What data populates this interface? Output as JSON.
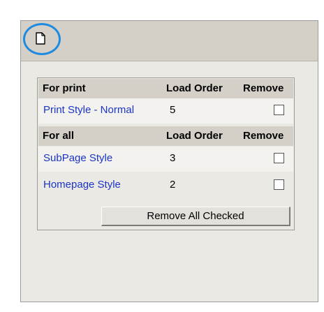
{
  "header": {
    "icon": "document-icon"
  },
  "print_section": {
    "name_header": "For print",
    "order_header": "Load Order",
    "remove_header": "Remove",
    "rows": [
      {
        "name": "Print Style - Normal",
        "order": "5",
        "checked": false
      }
    ]
  },
  "all_section": {
    "name_header": "For all",
    "order_header": "Load Order",
    "remove_header": "Remove",
    "rows": [
      {
        "name": "SubPage Style",
        "order": "3",
        "checked": false
      },
      {
        "name": "Homepage Style",
        "order": "2",
        "checked": false
      }
    ]
  },
  "remove_all_label": "Remove All Checked",
  "colors": {
    "highlight_ring": "#1e8be0",
    "link": "#1a35c8",
    "panel": "#ebe9e4",
    "header": "#d4d0c8"
  }
}
